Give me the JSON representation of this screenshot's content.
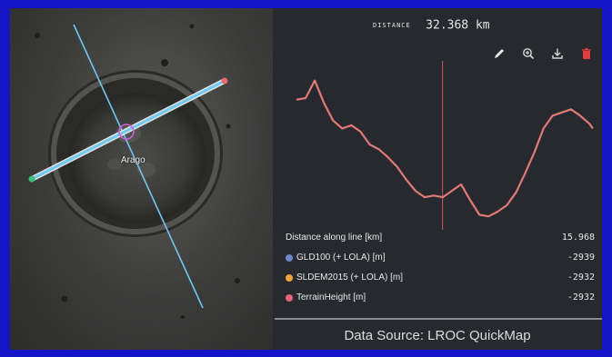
{
  "map": {
    "crater_name": "Arago"
  },
  "panel": {
    "distance_label": "DISTANCE",
    "distance_value": "32.368 km",
    "tools": [
      {
        "name": "pencil-icon"
      },
      {
        "name": "zoom-in-icon"
      },
      {
        "name": "download-icon"
      },
      {
        "name": "trash-icon"
      }
    ],
    "legend": [
      {
        "label": "Distance along line [km]",
        "value": "15.968",
        "color": ""
      },
      {
        "label": "GLD100 (+ LOLA) [m]",
        "value": "-2939",
        "color": "#6f86c8"
      },
      {
        "label": "SLDEM2015 (+ LOLA) [m]",
        "value": "-2932",
        "color": "#f0a23c"
      },
      {
        "label": "TerrainHeight [m]",
        "value": "-2932",
        "color": "#e8667c"
      }
    ],
    "source_text": "Data Source: LROC QuickMap"
  },
  "colors": {
    "profile_line": "#e07a78",
    "cursor_line": "#d65a5a",
    "track_line": "#6fc8ee",
    "frame_border": "#1414c8"
  },
  "chart_data": {
    "type": "line",
    "x": [
      0,
      1,
      2,
      3,
      4,
      5,
      6,
      7,
      8,
      9,
      10,
      11,
      12,
      13,
      14,
      15,
      16,
      17,
      18,
      19,
      20,
      21,
      22,
      23,
      24,
      25,
      26,
      27,
      28,
      29,
      30,
      31,
      32,
      32.4
    ],
    "series": [
      {
        "values": [
          0.78,
          0.79,
          0.9,
          0.76,
          0.65,
          0.6,
          0.62,
          0.58,
          0.5,
          0.47,
          0.42,
          0.36,
          0.28,
          0.21,
          0.17,
          0.18,
          0.17,
          0.21,
          0.25,
          0.15,
          0.06,
          0.05,
          0.08,
          0.12,
          0.2,
          0.32,
          0.45,
          0.6,
          0.68,
          0.7,
          0.72,
          0.68,
          0.63,
          0.6
        ]
      }
    ],
    "cursor_x": 15.968,
    "grid": false,
    "legend": "below"
  }
}
